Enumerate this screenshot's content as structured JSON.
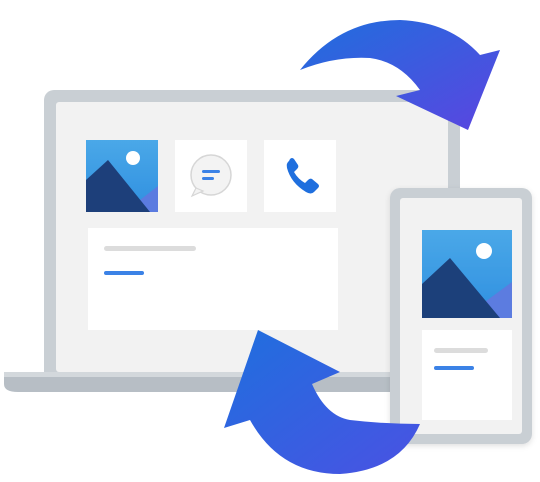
{
  "illustration": {
    "icons": {
      "photo": "photo-icon",
      "message": "message-bubble-icon",
      "phone": "phone-icon",
      "sync_arrow": "curved-arrow-icon"
    },
    "colors": {
      "background": "#ffffff",
      "device_frame": "#c9cfd4",
      "device_frame_dark": "#a9b1b8",
      "screen": "#f2f2f2",
      "card": "#ffffff",
      "placeholder_line": "#dcdcdc",
      "accent_line": "#3b82e6",
      "arrow_start": "#1f6fde",
      "arrow_end": "#5b45e0",
      "photo_sky": "#4aa8e8",
      "photo_mountain_dark": "#1d3f7a",
      "photo_mountain_light": "#5b7be0",
      "sun": "#ffffff"
    }
  }
}
